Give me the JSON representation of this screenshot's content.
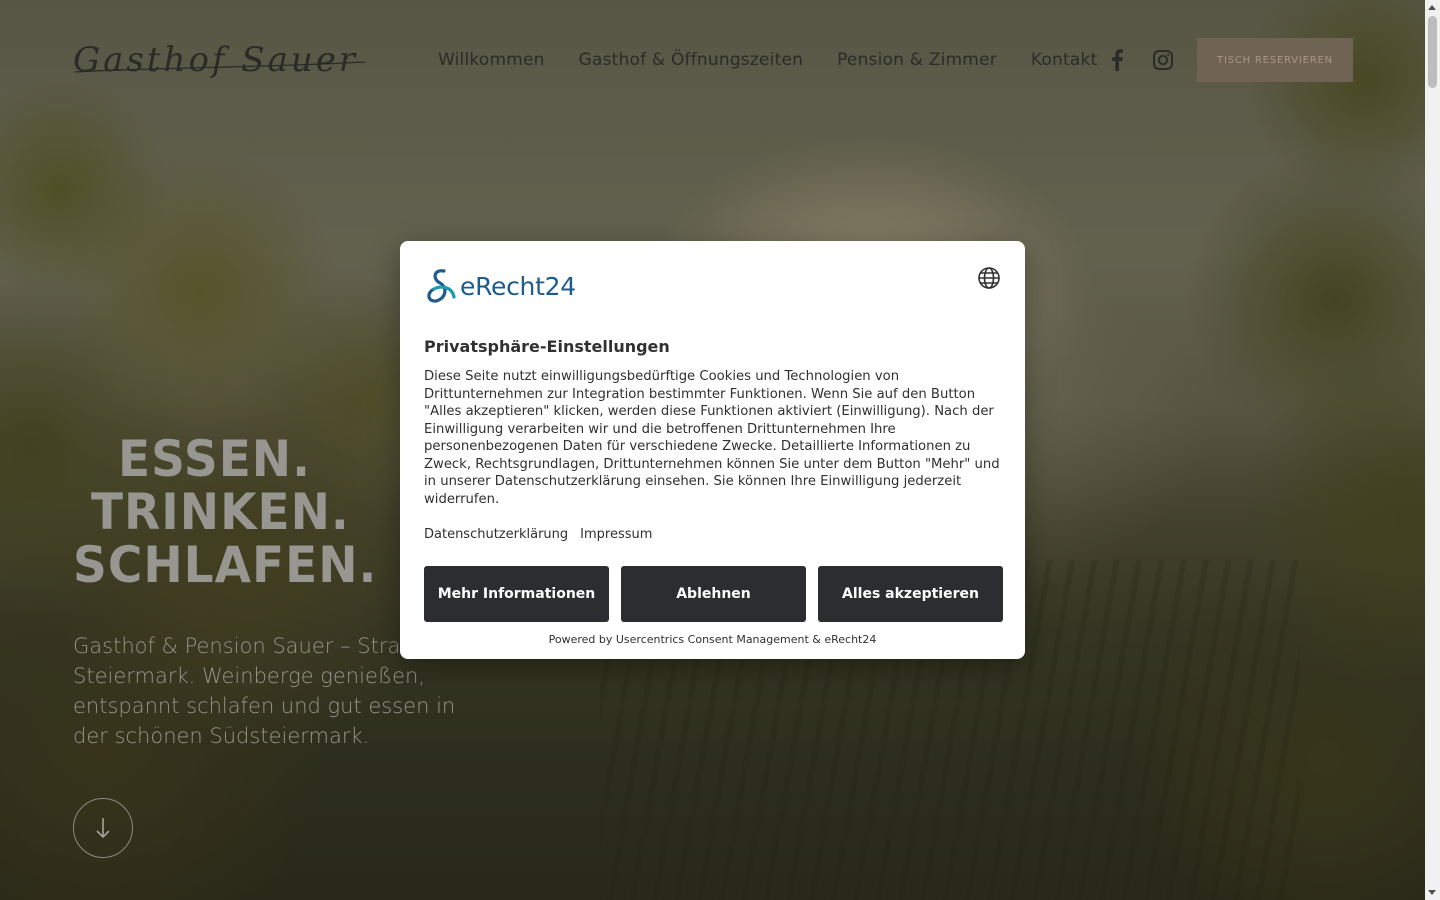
{
  "header": {
    "logo_text": "Gasthof Sauer",
    "nav": [
      {
        "label": "Willkommen"
      },
      {
        "label": "Gasthof & Öffnungszeiten"
      },
      {
        "label": "Pension & Zimmer"
      },
      {
        "label": "Kontakt"
      }
    ],
    "social_icons": [
      "facebook-icon",
      "instagram-icon"
    ],
    "reserve_label": "TISCH RESERVIEREN"
  },
  "hero": {
    "headline": [
      "ESSEN.",
      "TRINKEN.",
      "SCHLAFEN."
    ],
    "subtext": "Gasthof & Pension Sauer – Strass in der Steiermark. Weinberge genießen, entspannt schlafen und gut essen in der schönen Südsteiermark.",
    "scroll_icon": "arrow-down-icon"
  },
  "consent": {
    "brand": "eRecht24",
    "language_icon": "globe-icon",
    "title": "Privatsphäre-Einstellungen",
    "description": "Diese Seite nutzt einwilligungsbedürftige Cookies und Technologien von Drittunternehmen zur Integration bestimmter Funktionen. Wenn Sie auf den Button \"Alles akzeptieren\" klicken, werden diese Funktionen aktiviert (Einwilligung). Nach der Einwilligung verarbeiten wir und die betroffenen Drittunternehmen Ihre personenbezogenen Daten für verschiedene Zwecke. Detaillierte Informationen zu Zweck, Rechtsgrundlagen, Drittunternehmen können Sie unter dem Button \"Mehr\" und in unserer Datenschutzerklärung einsehen. Sie können Ihre Einwilligung jederzeit widerrufen.",
    "links": [
      "Datenschutzerklärung",
      "Impressum"
    ],
    "buttons": {
      "more": "Mehr Informationen",
      "deny": "Ablehnen",
      "accept": "Alles akzeptieren"
    },
    "powered_by": "Powered by Usercentrics Consent Management & eRecht24"
  },
  "colors": {
    "brand_blue": "#1f5b8c",
    "brand_teal": "#1a9bb0",
    "button_dark": "#2b2d31",
    "reserve_button": "#6f6353"
  }
}
